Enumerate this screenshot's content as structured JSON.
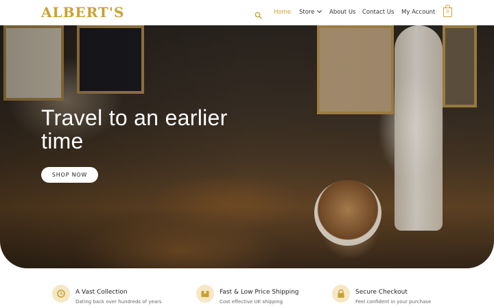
{
  "header": {
    "logo": "ALBERT'S",
    "nav": [
      {
        "label": "Home",
        "active": true
      },
      {
        "label": "Store",
        "has_dropdown": true
      },
      {
        "label": "About Us"
      },
      {
        "label": "Contact Us"
      },
      {
        "label": "My Account"
      }
    ],
    "cart_count": "0",
    "accent_color": "#c9a132",
    "icons": [
      "search-icon",
      "cart-icon"
    ]
  },
  "hero": {
    "title": "Travel to an earlier time",
    "button_label": "SHOP NOW"
  },
  "features": [
    {
      "icon": "history-icon",
      "title": "A Vast Collection",
      "text": "Dating back over hundreds of years"
    },
    {
      "icon": "box-icon",
      "title": "Fast & Low Price Shipping",
      "text": "Cost effective UK shipping"
    },
    {
      "icon": "lock-icon",
      "title": "Secure Checkout",
      "text": "Feel confident in your purchase"
    }
  ]
}
